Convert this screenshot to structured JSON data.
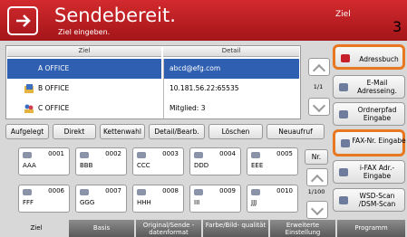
{
  "header": {
    "title": "Sendebereit.",
    "subtitle": "Ziel eingeben.",
    "right_label": "Ziel",
    "callout_number": "3"
  },
  "destinations": {
    "col_name": "Ziel",
    "col_detail": "Detail",
    "page": "1/1",
    "rows": [
      {
        "name": "A OFFICE",
        "detail": "abcd@efg.com",
        "icon": "email-icon"
      },
      {
        "name": "B OFFICE",
        "detail": "10.181.56.22:65535",
        "icon": "folder-icon"
      },
      {
        "name": "C OFFICE",
        "detail": "Mitglied:    3",
        "icon": "group-icon"
      }
    ]
  },
  "right_buttons": [
    "Adressbuch",
    "E-Mail Adresseing.",
    "Ordnerpfad Eingabe",
    "FAX-Nr. Eingabe",
    "i-FAX Adr.-Eingabe",
    "WSD-Scan /DSM-Scan"
  ],
  "toolbar": [
    "Aufgelegt",
    "Direkt",
    "Kettenwahl",
    "Detail/Bearb.",
    "Löschen",
    "Neuaufruf"
  ],
  "onetouch": {
    "nr_label": "Nr.",
    "page": "1/100",
    "keys": [
      {
        "num": "0001",
        "label": "AAA"
      },
      {
        "num": "0002",
        "label": "BBB"
      },
      {
        "num": "0003",
        "label": "CCC"
      },
      {
        "num": "0004",
        "label": "DDD"
      },
      {
        "num": "0005",
        "label": "EEE"
      },
      {
        "num": "0006",
        "label": "FFF"
      },
      {
        "num": "0007",
        "label": "GGG"
      },
      {
        "num": "0008",
        "label": "HHH"
      },
      {
        "num": "0009",
        "label": "III"
      },
      {
        "num": "0010",
        "label": "JJJ"
      }
    ]
  },
  "tabs": [
    "Ziel",
    "Basis",
    "Original/Sende -datenformat",
    "Farbe/Bild- qualität",
    "Erweiterte Einstellung",
    "Programm"
  ],
  "colors": {
    "header": "#c8202a",
    "selection": "#2f5fb0",
    "highlight": "#e87722"
  }
}
